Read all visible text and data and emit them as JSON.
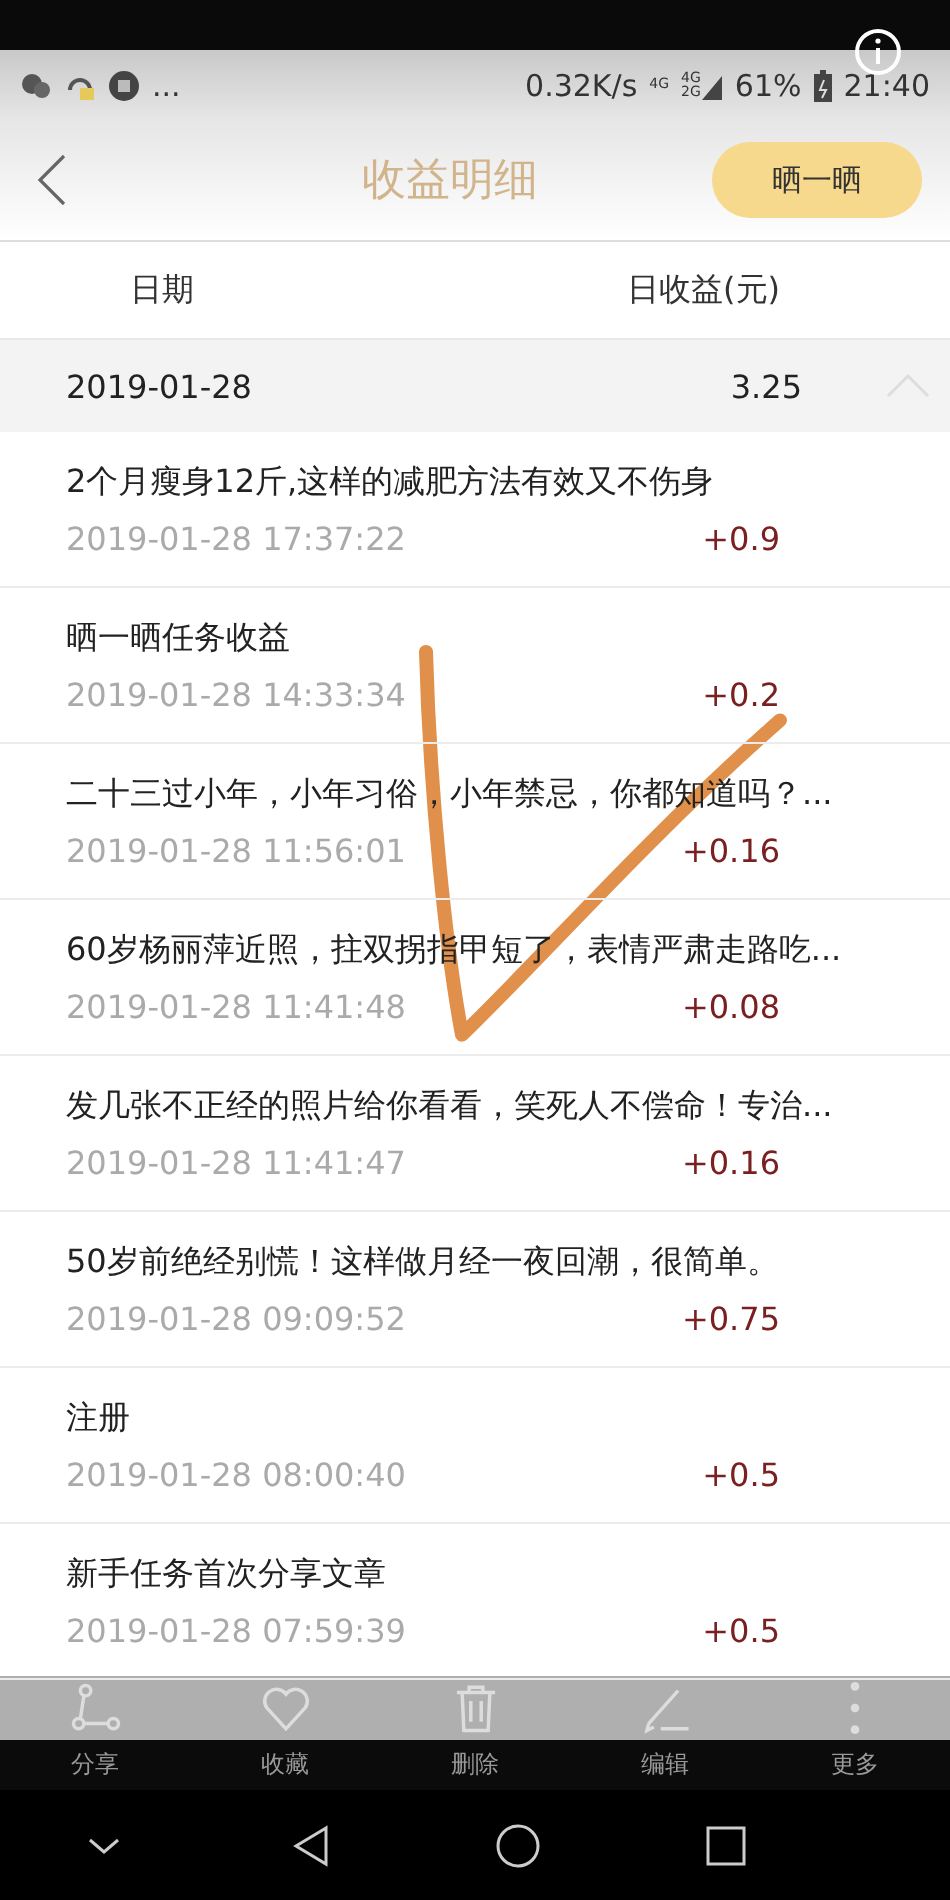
{
  "status_bar": {
    "more": "...",
    "network_speed": "0.32K/s",
    "sim1": "4G",
    "sim2": [
      "4G",
      "2G"
    ],
    "battery": "61%",
    "time": "21:40"
  },
  "header": {
    "title": "收益明细",
    "action": "晒一晒"
  },
  "columns": [
    "日期",
    "日收益(元)"
  ],
  "group": {
    "date": "2019-01-28",
    "total": "3.25",
    "expanded": true
  },
  "entries": [
    {
      "title": "2个月瘦身12斤,这样的减肥方法有效又不伤身",
      "time": "2019-01-28 17:37:22",
      "amount": "+0.9"
    },
    {
      "title": "晒一晒任务收益",
      "time": "2019-01-28 14:33:34",
      "amount": "+0.2"
    },
    {
      "title": "二十三过小年，小年习俗，小年禁忌，你都知道吗？...",
      "time": "2019-01-28 11:56:01",
      "amount": "+0.16"
    },
    {
      "title": "60岁杨丽萍近照，拄双拐指甲短了，表情严肃走路吃...",
      "time": "2019-01-28 11:41:48",
      "amount": "+0.08"
    },
    {
      "title": "发几张不正经的照片给你看看，笑死人不偿命！专治...",
      "time": "2019-01-28 11:41:47",
      "amount": "+0.16"
    },
    {
      "title": "50岁前绝经别慌！这样做月经一夜回潮，很简单。",
      "time": "2019-01-28 09:09:52",
      "amount": "+0.75"
    },
    {
      "title": "注册",
      "time": "2019-01-28 08:00:40",
      "amount": "+0.5"
    },
    {
      "title": "新手任务首次分享文章",
      "time": "2019-01-28 07:59:39",
      "amount": "+0.5"
    }
  ],
  "toolbar": [
    {
      "kind": "share",
      "label": "分享"
    },
    {
      "kind": "favorite",
      "label": "收藏"
    },
    {
      "kind": "delete",
      "label": "删除"
    },
    {
      "kind": "edit",
      "label": "编辑"
    },
    {
      "kind": "more",
      "label": "更多"
    }
  ]
}
